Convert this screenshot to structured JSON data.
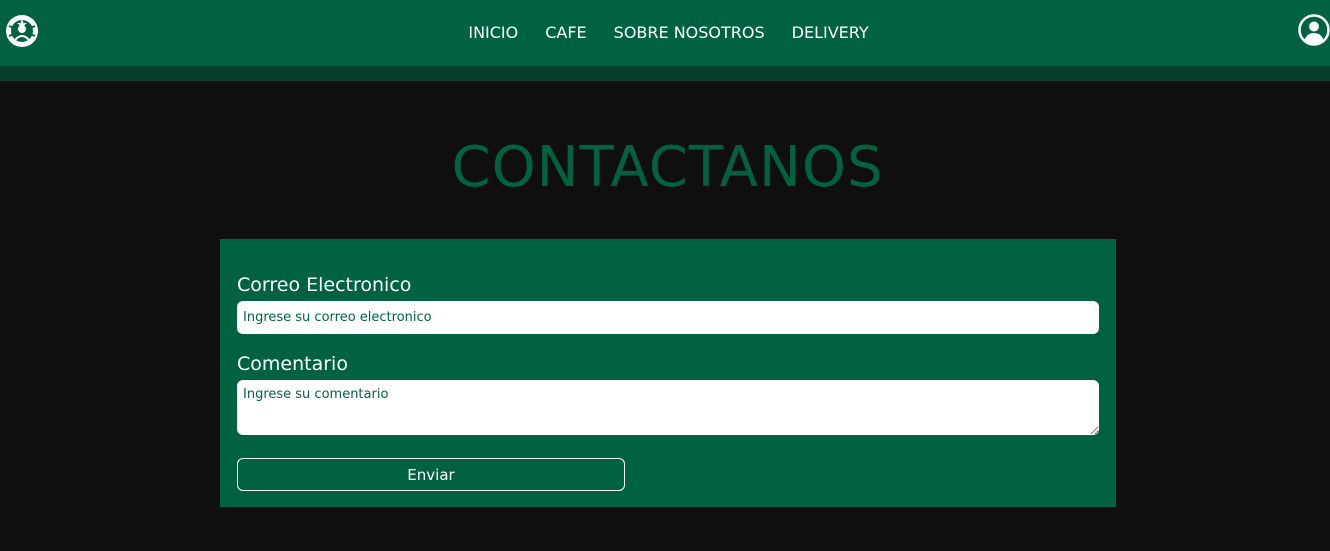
{
  "navbar": {
    "logo_icon": "siren-logo-icon",
    "links": [
      "INICIO",
      "CAFE",
      "SOBRE NOSOTROS",
      "DELIVERY"
    ],
    "user_icon": "user-circle-icon"
  },
  "page": {
    "title": "CONTACTANOS"
  },
  "form": {
    "email_label": "Correo Electronico",
    "email_placeholder": "Ingrese su correo electronico",
    "email_value": "",
    "comment_label": "Comentario",
    "comment_placeholder": "Ingrese su comentario",
    "comment_value": "",
    "submit_label": "Enviar"
  },
  "colors": {
    "brand_green": "#006241",
    "nav_shadow": "#063d2b",
    "background": "#0f0f0f",
    "text_white": "#ffffff"
  }
}
